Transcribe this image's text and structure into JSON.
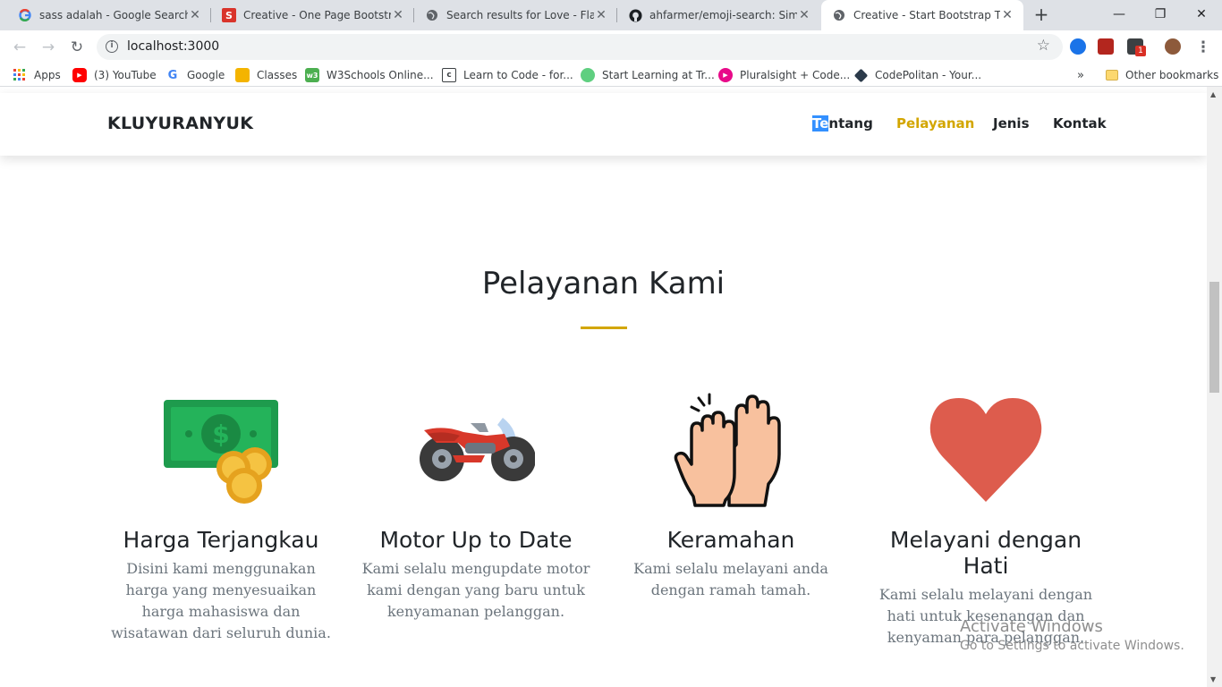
{
  "browser": {
    "tabs": [
      {
        "title": "sass adalah - Google Search",
        "favicon": "google-icon"
      },
      {
        "title": "Creative - One Page Bootstrap",
        "favicon": "s-icon"
      },
      {
        "title": "Search results for Love - Flatic",
        "favicon": "globe-icon"
      },
      {
        "title": "ahfarmer/emoji-search: Simple",
        "favicon": "github-icon"
      },
      {
        "title": "Creative - Start Bootstrap Ther",
        "favicon": "globe-icon"
      }
    ],
    "url": "localhost:3000",
    "bookmarks": [
      {
        "label": "Apps",
        "icon": "apps-grid-icon"
      },
      {
        "label": "(3) YouTube",
        "icon": "youtube-icon"
      },
      {
        "label": "Google",
        "icon": "google-icon"
      },
      {
        "label": "Classes",
        "icon": "classroom-icon"
      },
      {
        "label": "W3Schools Online...",
        "icon": "w3schools-icon"
      },
      {
        "label": "Learn to Code - for...",
        "icon": "freecodecamp-icon"
      },
      {
        "label": "Start Learning at Tr...",
        "icon": "treehouse-icon"
      },
      {
        "label": "Pluralsight + Code...",
        "icon": "pluralsight-icon"
      },
      {
        "label": "CodePolitan - Your...",
        "icon": "codepolitan-icon"
      }
    ],
    "overflow": "»",
    "other_bookmarks": "Other bookmarks",
    "extension_badge": "1"
  },
  "page": {
    "brand": "KLUYURANYUK",
    "nav": {
      "tentang_highlight": "Te",
      "tentang_rest": "ntang",
      "pelayanan": "Pelayanan",
      "jenis": "Jenis",
      "kontak": "Kontak"
    },
    "section_title": "Pelayanan Kami",
    "services": [
      {
        "title": "Harga Terjangkau",
        "text": "Disini kami menggunakan harga yang menyesuaikan harga mahasiswa dan wisatawan dari seluruh dunia.",
        "icon": "money-icon"
      },
      {
        "title": "Motor Up to Date",
        "text": "Kami selalu mengupdate motor kami dengan yang baru untuk kenyamanan pelanggan.",
        "icon": "motorcycle-icon"
      },
      {
        "title": "Keramahan",
        "text": "Kami selalu melayani anda dengan ramah tamah.",
        "icon": "high-five-icon"
      },
      {
        "title": "Melayani dengan Hati",
        "text": "Kami selalu melayani dengan hati untuk kesenangan dan kenyaman para pelanggan.",
        "icon": "heart-icon"
      }
    ],
    "colors": {
      "accent": "#d3a600",
      "text": "#212529",
      "muted": "#6c757d",
      "heart": "#dd5c4d"
    }
  },
  "watermark": {
    "line1": "Activate Windows",
    "line2": "Go to Settings to activate Windows."
  }
}
